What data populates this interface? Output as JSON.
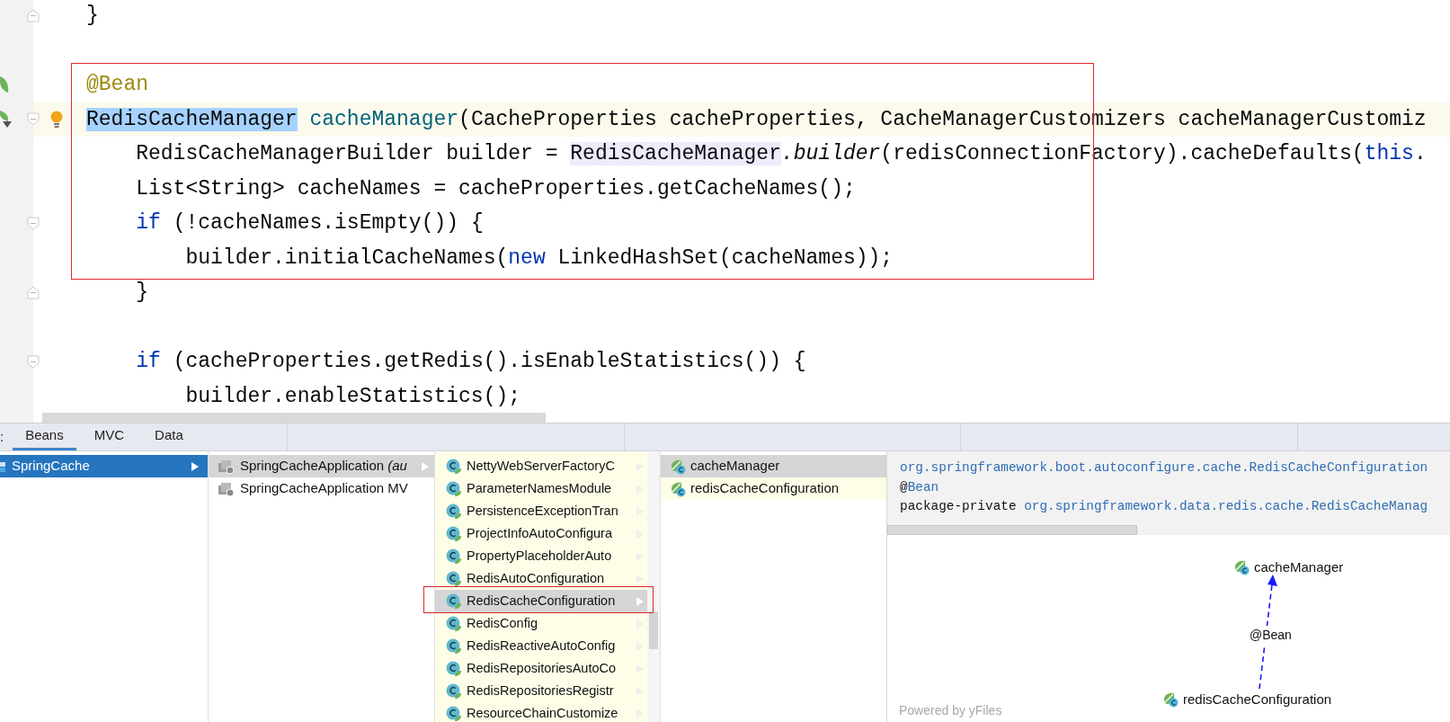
{
  "editor": {
    "lines": [
      {
        "kind": "code",
        "fold_end": true,
        "tokens": [
          {
            "kind": "plain",
            "text": "}"
          }
        ]
      },
      {
        "kind": "blank"
      },
      {
        "kind": "code",
        "bean_marker": true,
        "tokens": [
          {
            "kind": "annotation",
            "text": "@Bean"
          }
        ]
      },
      {
        "kind": "code",
        "navigation_marker": true,
        "fold_start": true,
        "current": true,
        "intention": true,
        "tokens": [
          {
            "kind": "selection",
            "text": "RedisCacheManager"
          },
          {
            "kind": "decl",
            "text": " cacheManager"
          },
          {
            "kind": "plain",
            "text": "(CacheProperties cacheProperties, CacheManagerCustomizers cacheManagerCustomiz"
          }
        ]
      },
      {
        "kind": "code",
        "tokens": [
          {
            "kind": "plain",
            "text": "    RedisCacheManagerBuilder builder = "
          },
          {
            "kind": "usage",
            "text": "RedisCacheManager"
          },
          {
            "kind": "static",
            "text": ".builder"
          },
          {
            "kind": "plain",
            "text": "(redisConnectionFactory).cacheDefaults("
          },
          {
            "kind": "keyword",
            "text": "this"
          },
          {
            "kind": "plain",
            "text": "."
          }
        ]
      },
      {
        "kind": "code",
        "tokens": [
          {
            "kind": "plain",
            "text": "    List<String> cacheNames = cacheProperties.getCacheNames();"
          }
        ]
      },
      {
        "kind": "code",
        "fold_start": true,
        "tokens": [
          {
            "kind": "keyword",
            "text": "    if"
          },
          {
            "kind": "plain",
            "text": " (!cacheNames.isEmpty()) {"
          }
        ]
      },
      {
        "kind": "code",
        "tokens": [
          {
            "kind": "plain",
            "text": "        builder.initialCacheNames("
          },
          {
            "kind": "keyword",
            "text": "new"
          },
          {
            "kind": "plain",
            "text": " LinkedHashSet(cacheNames));"
          }
        ]
      },
      {
        "kind": "code",
        "fold_end": true,
        "tokens": [
          {
            "kind": "plain",
            "text": "    }"
          }
        ]
      },
      {
        "kind": "blank"
      },
      {
        "kind": "code",
        "fold_start": true,
        "tokens": [
          {
            "kind": "keyword",
            "text": "    if"
          },
          {
            "kind": "plain",
            "text": " (cacheProperties.getRedis().isEnableStatistics()) {"
          }
        ]
      },
      {
        "kind": "code",
        "tokens": [
          {
            "kind": "plain",
            "text": "        builder.enableStatistics();"
          }
        ]
      }
    ]
  },
  "panel": {
    "label": ":",
    "tabs": [
      {
        "label": "Beans",
        "selected": true
      },
      {
        "label": "MVC",
        "selected": false
      },
      {
        "label": "Data",
        "selected": false
      }
    ],
    "modules": [
      {
        "name": "SpringCache",
        "selected": true
      }
    ],
    "contexts": [
      {
        "name": "SpringCacheApplication *(au*",
        "selected": true
      },
      {
        "name": "SpringCacheApplication MV",
        "selected": false
      }
    ],
    "configurations": [
      {
        "name": "NettyWebServerFactoryC",
        "selected": false
      },
      {
        "name": "ParameterNamesModule",
        "selected": false
      },
      {
        "name": "PersistenceExceptionTran",
        "selected": false
      },
      {
        "name": "ProjectInfoAutoConfigura",
        "selected": false
      },
      {
        "name": "PropertyPlaceholderAuto",
        "selected": false
      },
      {
        "name": "RedisAutoConfiguration",
        "selected": false
      },
      {
        "name": "RedisCacheConfiguration",
        "selected": true
      },
      {
        "name": "RedisConfig",
        "selected": false
      },
      {
        "name": "RedisReactiveAutoConfig",
        "selected": false
      },
      {
        "name": "RedisRepositoriesAutoCo",
        "selected": false
      },
      {
        "name": "RedisRepositoriesRegistr",
        "selected": false
      },
      {
        "name": "ResourceChainCustomize",
        "selected": false
      }
    ],
    "beans": [
      {
        "name": "cacheManager",
        "selected": true
      },
      {
        "name": "redisCacheConfiguration",
        "selected": false
      }
    ],
    "details": [
      [
        {
          "kind": "link",
          "text": "org.springframework.boot.autoconfigure.cache.RedisCacheConfiguration"
        }
      ],
      [
        {
          "kind": "plain",
          "text": "@"
        },
        {
          "kind": "link",
          "text": "Bean"
        }
      ],
      [
        {
          "kind": "plain",
          "text": "package-private "
        },
        {
          "kind": "link",
          "text": "org.springframework.data.redis.cache.RedisCacheManag"
        }
      ]
    ],
    "graph": {
      "target": "cacheManager",
      "source": "redisCacheConfiguration",
      "edge_label": "@Bean",
      "footer": "Powered by yFiles"
    }
  }
}
